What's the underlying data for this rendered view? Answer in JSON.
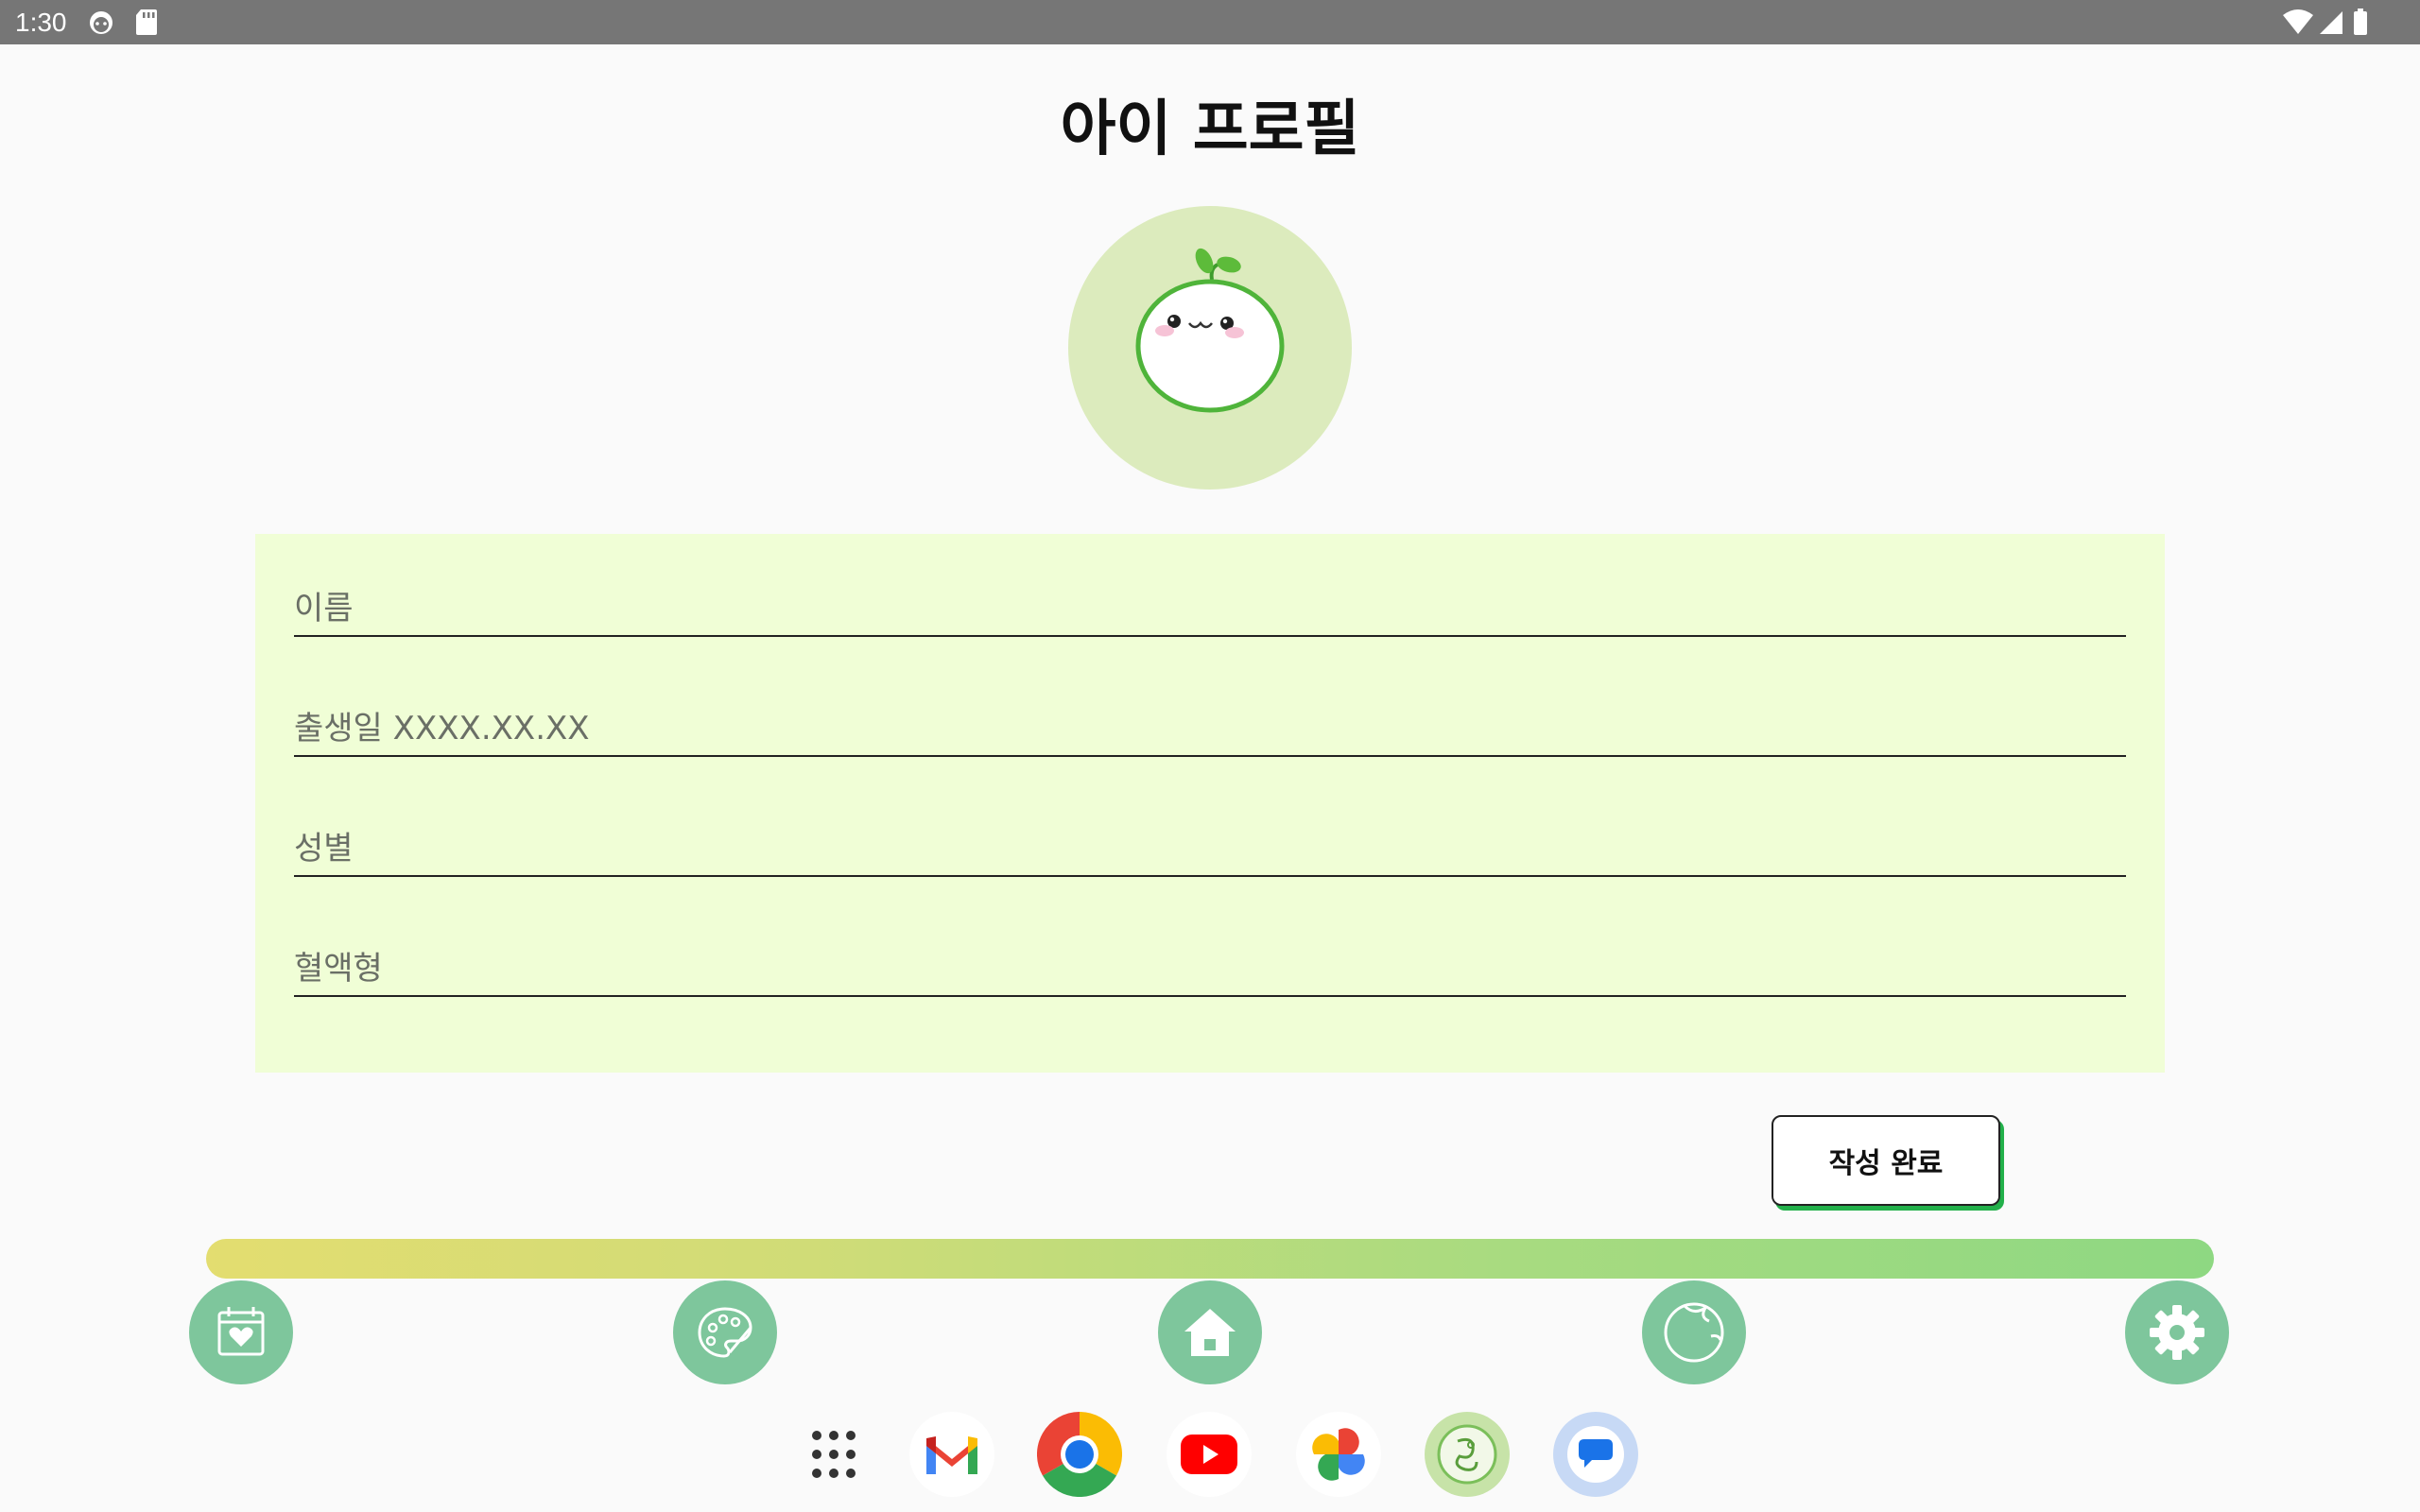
{
  "status_bar": {
    "time": "1:30"
  },
  "page": {
    "title": "아이 프로필"
  },
  "form": {
    "fields": [
      {
        "label": "이름"
      },
      {
        "label": "출생일 XXXX.XX.XX"
      },
      {
        "label": "성별"
      },
      {
        "label": "혈액형"
      }
    ],
    "partial_next_field": "· · · ·"
  },
  "submit": {
    "label": "작성 완료"
  },
  "bottom_nav": {
    "items": [
      {
        "icon": "calendar-heart-icon"
      },
      {
        "icon": "palette-icon"
      },
      {
        "icon": "home-icon"
      },
      {
        "icon": "baby-face-icon"
      },
      {
        "icon": "gear-icon"
      }
    ],
    "color": "#7ec69c"
  },
  "dock": {
    "apps": [
      "app-drawer",
      "gmail",
      "chrome",
      "youtube",
      "photos",
      "sprout-app",
      "messages"
    ]
  },
  "colors": {
    "panel": "#f0fed6",
    "avatar_bg": "#dcebbd",
    "accent_green": "#22b04a"
  }
}
